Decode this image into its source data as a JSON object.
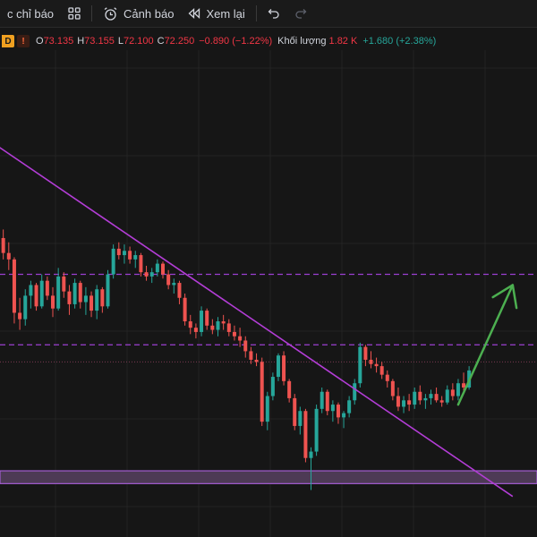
{
  "toolbar": {
    "indicators_label": "c chỉ báo",
    "alerts_label": "Cảnh báo",
    "replay_label": "Xem lại"
  },
  "legend": {
    "interval_badge": "D",
    "exchange_badge": "!",
    "open_key": "O",
    "open": "73.135",
    "high_key": "H",
    "high": "73.155",
    "low_key": "L",
    "low": "72.100",
    "close_key": "C",
    "close": "72.250",
    "change": "−0.890 (−1.22%)",
    "volume_title": "Khối lượng",
    "volume": "1.82 K",
    "volume_change": "+1.680 (+2.38%)"
  },
  "colors": {
    "up": "#26a69a",
    "down": "#ef5350",
    "trendline": "#b33dd6",
    "level": "#9c3fd1",
    "zone_fill": "#4d3a55",
    "arrow": "#4caf50",
    "background": "#161616"
  },
  "chart_data": {
    "type": "candlestick",
    "title": "",
    "xlabel": "",
    "ylabel": "",
    "y_range": [
      61.6,
      84.4
    ],
    "grid": true,
    "dashed_levels": [
      73.9,
      70.6
    ],
    "dotted_level": 69.8,
    "support_zone": [
      64.1,
      64.7
    ],
    "trendline": [
      [
        0,
        79.9
      ],
      [
        94,
        63.5
      ]
    ],
    "arrow": [
      [
        84,
        67.8
      ],
      [
        94,
        73.4
      ]
    ],
    "candles": [
      [
        76.8,
        77.4,
        75.3,
        75.6
      ],
      [
        75.6,
        76.0,
        74.6,
        74.9
      ],
      [
        74.9,
        75.4,
        74.1,
        74.6
      ],
      [
        74.6,
        74.7,
        71.6,
        72.1
      ],
      [
        72.1,
        72.8,
        71.3,
        71.8
      ],
      [
        71.8,
        73.2,
        71.5,
        72.9
      ],
      [
        72.9,
        73.6,
        72.3,
        73.4
      ],
      [
        73.4,
        73.5,
        72.2,
        72.4
      ],
      [
        72.4,
        73.9,
        72.3,
        73.6
      ],
      [
        73.6,
        73.8,
        72.7,
        72.9
      ],
      [
        72.9,
        73.3,
        71.9,
        72.3
      ],
      [
        72.3,
        74.2,
        72.2,
        73.8
      ],
      [
        73.8,
        74.0,
        72.8,
        73.1
      ],
      [
        73.1,
        73.4,
        72.0,
        72.5
      ],
      [
        72.5,
        73.7,
        72.3,
        73.5
      ],
      [
        73.5,
        73.6,
        72.3,
        72.6
      ],
      [
        72.6,
        73.3,
        72.0,
        72.9
      ],
      [
        72.9,
        73.1,
        71.9,
        72.2
      ],
      [
        72.2,
        73.4,
        71.8,
        73.2
      ],
      [
        73.2,
        73.3,
        72.1,
        72.4
      ],
      [
        72.4,
        74.1,
        72.3,
        73.9
      ],
      [
        73.9,
        75.3,
        73.7,
        75.1
      ],
      [
        75.1,
        75.4,
        74.6,
        74.8
      ],
      [
        74.8,
        75.3,
        74.4,
        75.0
      ],
      [
        75.0,
        75.2,
        74.4,
        74.6
      ],
      [
        74.6,
        75.0,
        74.2,
        74.8
      ],
      [
        74.8,
        74.9,
        73.8,
        74.0
      ],
      [
        74.0,
        74.3,
        73.6,
        73.8
      ],
      [
        73.8,
        74.2,
        73.5,
        74.0
      ],
      [
        74.0,
        74.6,
        73.8,
        74.4
      ],
      [
        74.4,
        74.5,
        73.7,
        73.9
      ],
      [
        73.9,
        74.1,
        73.2,
        73.4
      ],
      [
        73.4,
        73.7,
        73.0,
        73.5
      ],
      [
        73.5,
        73.6,
        72.5,
        72.8
      ],
      [
        72.8,
        73.0,
        71.5,
        71.7
      ],
      [
        71.7,
        72.0,
        71.1,
        71.4
      ],
      [
        71.4,
        71.6,
        70.9,
        71.2
      ],
      [
        71.2,
        72.4,
        71.0,
        72.2
      ],
      [
        72.2,
        72.3,
        71.3,
        71.5
      ],
      [
        71.5,
        71.8,
        71.1,
        71.3
      ],
      [
        71.3,
        71.9,
        71.0,
        71.7
      ],
      [
        71.7,
        72.0,
        71.3,
        71.6
      ],
      [
        71.6,
        71.8,
        71.0,
        71.2
      ],
      [
        71.2,
        71.5,
        70.8,
        71.0
      ],
      [
        71.0,
        71.4,
        70.5,
        70.8
      ],
      [
        70.8,
        71.0,
        70.0,
        70.3
      ],
      [
        70.3,
        70.5,
        69.7,
        69.9
      ],
      [
        69.9,
        70.2,
        69.6,
        69.8
      ],
      [
        69.8,
        70.0,
        66.8,
        67.0
      ],
      [
        67.0,
        68.4,
        66.6,
        68.2
      ],
      [
        68.2,
        69.3,
        68.0,
        69.1
      ],
      [
        69.1,
        70.2,
        68.9,
        70.1
      ],
      [
        70.1,
        70.3,
        68.7,
        68.9
      ],
      [
        68.9,
        69.0,
        67.9,
        68.1
      ],
      [
        68.1,
        68.3,
        66.6,
        66.8
      ],
      [
        66.8,
        67.7,
        66.4,
        67.5
      ],
      [
        67.5,
        67.6,
        65.1,
        65.3
      ],
      [
        65.3,
        65.8,
        63.8,
        65.6
      ],
      [
        65.6,
        67.8,
        65.4,
        67.6
      ],
      [
        67.6,
        68.6,
        67.4,
        68.4
      ],
      [
        68.4,
        68.5,
        67.3,
        67.5
      ],
      [
        67.5,
        68.0,
        67.0,
        67.8
      ],
      [
        67.8,
        67.9,
        66.9,
        67.2
      ],
      [
        67.2,
        67.5,
        66.7,
        67.4
      ],
      [
        67.4,
        68.2,
        67.2,
        68.0
      ],
      [
        68.0,
        69.0,
        67.8,
        68.8
      ],
      [
        68.8,
        70.7,
        68.6,
        70.5
      ],
      [
        70.5,
        70.6,
        69.6,
        69.9
      ],
      [
        69.9,
        70.3,
        69.5,
        69.7
      ],
      [
        69.7,
        70.0,
        69.3,
        69.6
      ],
      [
        69.6,
        69.8,
        69.0,
        69.2
      ],
      [
        69.2,
        69.4,
        68.6,
        68.9
      ],
      [
        68.9,
        69.0,
        68.0,
        68.2
      ],
      [
        68.2,
        68.6,
        67.5,
        67.7
      ],
      [
        67.7,
        68.2,
        67.4,
        68.0
      ],
      [
        68.0,
        68.3,
        67.5,
        67.8
      ],
      [
        67.8,
        68.6,
        67.6,
        68.4
      ],
      [
        68.4,
        68.7,
        67.8,
        68.0
      ],
      [
        68.0,
        68.3,
        67.6,
        68.1
      ],
      [
        68.1,
        68.5,
        67.8,
        68.3
      ],
      [
        68.3,
        68.6,
        67.9,
        68.0
      ],
      [
        68.0,
        68.2,
        67.7,
        67.9
      ],
      [
        67.9,
        68.7,
        67.8,
        68.5
      ],
      [
        68.5,
        68.8,
        68.0,
        68.2
      ],
      [
        68.2,
        69.0,
        68.0,
        68.8
      ],
      [
        68.8,
        69.3,
        68.4,
        68.6
      ],
      [
        68.6,
        69.6,
        68.5,
        69.4
      ]
    ]
  }
}
